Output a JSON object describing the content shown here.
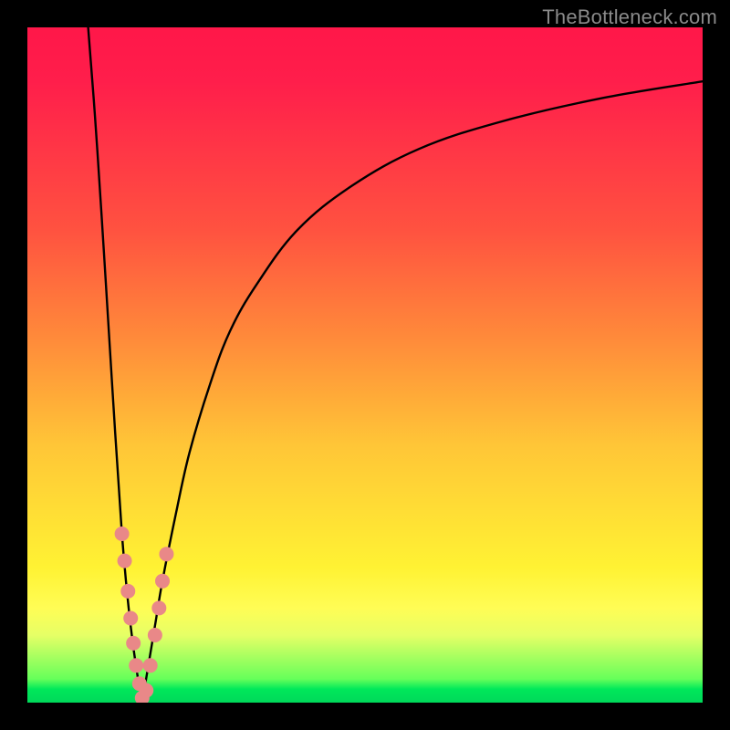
{
  "watermark": "TheBottleneck.com",
  "colors": {
    "background_frame": "#000000",
    "curve_stroke": "#000000",
    "dot_fill": "#e98888",
    "gradient_top": "#ff1749",
    "gradient_mid1": "#ff8a3a",
    "gradient_mid2": "#fff233",
    "gradient_bottom": "#00d85a"
  },
  "chart_data": {
    "type": "line",
    "title": "",
    "xlabel": "",
    "ylabel": "",
    "xlim": [
      0,
      100
    ],
    "ylim": [
      0,
      100
    ],
    "grid": false,
    "legend": false,
    "series": [
      {
        "name": "left-branch",
        "x": [
          9,
          10,
          11,
          12,
          13,
          14,
          15,
          16,
          17
        ],
        "y": [
          100,
          87,
          72,
          56,
          40,
          25,
          14,
          6,
          0
        ]
      },
      {
        "name": "right-branch",
        "x": [
          17,
          18,
          19,
          20,
          22,
          24,
          27,
          30,
          34,
          40,
          48,
          58,
          70,
          85,
          100
        ],
        "y": [
          0,
          6,
          12,
          18,
          28,
          37,
          47,
          55,
          62,
          70,
          76.5,
          82,
          86,
          89.5,
          92
        ]
      }
    ],
    "marker_points": {
      "name": "highlight-dots",
      "points_xy": [
        [
          14.0,
          25.0
        ],
        [
          14.4,
          21.0
        ],
        [
          14.9,
          16.5
        ],
        [
          15.3,
          12.5
        ],
        [
          15.7,
          8.8
        ],
        [
          16.1,
          5.5
        ],
        [
          16.6,
          2.8
        ],
        [
          17.0,
          0.7
        ],
        [
          17.6,
          1.8
        ],
        [
          18.2,
          5.5
        ],
        [
          18.9,
          10.0
        ],
        [
          19.5,
          14.0
        ],
        [
          20.0,
          18.0
        ],
        [
          20.6,
          22.0
        ]
      ],
      "radius_px": 8
    },
    "notes": "Two smooth curved branches meeting at a sharp cusp near x≈17, y≈0. Values are approximate readings from the rendered figure (no axes shown). Salmon dots cluster along both branches near the cusp."
  }
}
